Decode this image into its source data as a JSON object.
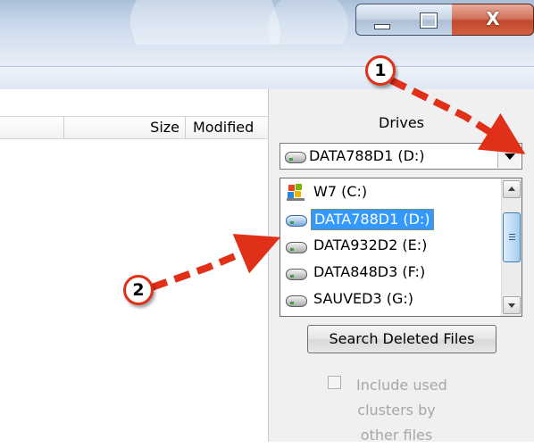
{
  "window": {
    "minimize_label": "",
    "maximize_label": "",
    "close_label": "X"
  },
  "file_list": {
    "columns": [
      {
        "label": ""
      },
      {
        "label": "Size"
      },
      {
        "label": "Modified"
      }
    ]
  },
  "drives_panel": {
    "label": "Drives",
    "selected_value": "DATA788D1 (D:)",
    "options": [
      {
        "label": "W7 (C:)",
        "icon": "windows-icon"
      },
      {
        "label": "DATA788D1 (D:)",
        "icon": "drive-icon",
        "selected": true
      },
      {
        "label": "DATA932D2 (E:)",
        "icon": "drive-icon"
      },
      {
        "label": "DATA848D3 (F:)",
        "icon": "drive-icon"
      },
      {
        "label": "SAUVED3 (G:)",
        "icon": "drive-icon"
      }
    ],
    "search_button_label": "Search Deleted Files",
    "include_checkbox": {
      "checked": false,
      "enabled": false,
      "lines": [
        "Include used",
        "clusters by",
        "other files"
      ]
    }
  },
  "annotations": {
    "callout_1": "1",
    "callout_2": "2",
    "arrow_color": "#e03017"
  }
}
